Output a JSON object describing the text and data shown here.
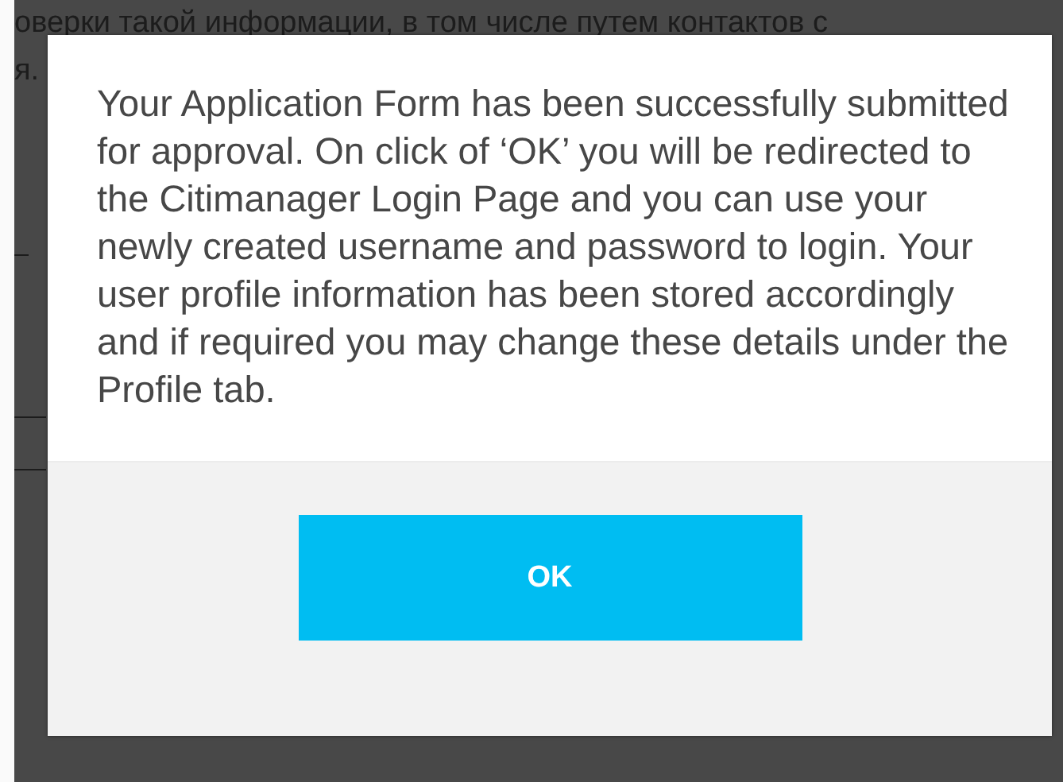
{
  "background_page": {
    "text_lines": [
      "оверки такой информации, в том числе путем контактов с",
      "я."
    ]
  },
  "dialog": {
    "message": "Your Application Form has been successfully submitted for approval. On click of ‘OK’ you will be redirected to the Citimanager Login Page and you can use your newly created username and password to login. Your user profile information has been stored accordingly and if required you may change these details under the Profile tab.",
    "buttons": [
      "OK"
    ]
  }
}
